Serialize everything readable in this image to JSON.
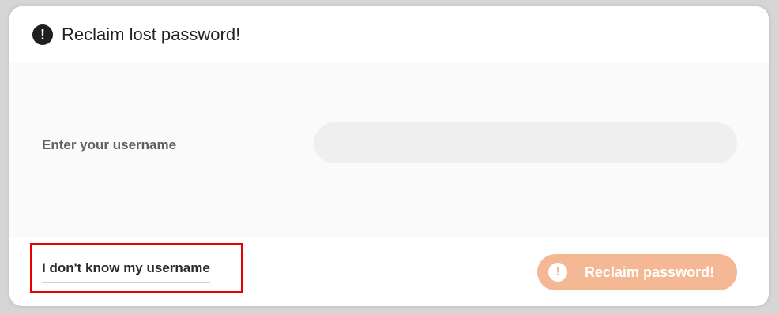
{
  "dialog": {
    "title": "Reclaim lost password!",
    "title_icon": "exclamation-circle-icon",
    "username_label": "Enter your username",
    "username_value": "",
    "username_placeholder": "",
    "forgot_username_link": "I don't know my username",
    "submit_label": "Reclaim password!",
    "submit_icon": "exclamation-circle-icon"
  },
  "colors": {
    "submit_button": "#f4b895",
    "highlight": "#e80000"
  }
}
